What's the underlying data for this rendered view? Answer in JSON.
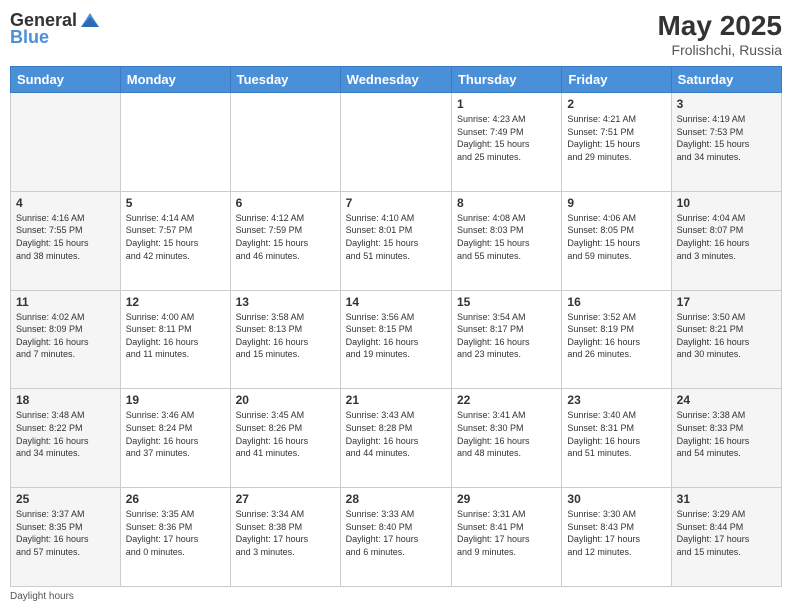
{
  "header": {
    "logo_general": "General",
    "logo_blue": "Blue",
    "month_year": "May 2025",
    "location": "Frolishchi, Russia"
  },
  "footer": {
    "note": "Daylight hours"
  },
  "days_of_week": [
    "Sunday",
    "Monday",
    "Tuesday",
    "Wednesday",
    "Thursday",
    "Friday",
    "Saturday"
  ],
  "weeks": [
    [
      {
        "day": "",
        "info": ""
      },
      {
        "day": "",
        "info": ""
      },
      {
        "day": "",
        "info": ""
      },
      {
        "day": "",
        "info": ""
      },
      {
        "day": "1",
        "info": "Sunrise: 4:23 AM\nSunset: 7:49 PM\nDaylight: 15 hours\nand 25 minutes."
      },
      {
        "day": "2",
        "info": "Sunrise: 4:21 AM\nSunset: 7:51 PM\nDaylight: 15 hours\nand 29 minutes."
      },
      {
        "day": "3",
        "info": "Sunrise: 4:19 AM\nSunset: 7:53 PM\nDaylight: 15 hours\nand 34 minutes."
      }
    ],
    [
      {
        "day": "4",
        "info": "Sunrise: 4:16 AM\nSunset: 7:55 PM\nDaylight: 15 hours\nand 38 minutes."
      },
      {
        "day": "5",
        "info": "Sunrise: 4:14 AM\nSunset: 7:57 PM\nDaylight: 15 hours\nand 42 minutes."
      },
      {
        "day": "6",
        "info": "Sunrise: 4:12 AM\nSunset: 7:59 PM\nDaylight: 15 hours\nand 46 minutes."
      },
      {
        "day": "7",
        "info": "Sunrise: 4:10 AM\nSunset: 8:01 PM\nDaylight: 15 hours\nand 51 minutes."
      },
      {
        "day": "8",
        "info": "Sunrise: 4:08 AM\nSunset: 8:03 PM\nDaylight: 15 hours\nand 55 minutes."
      },
      {
        "day": "9",
        "info": "Sunrise: 4:06 AM\nSunset: 8:05 PM\nDaylight: 15 hours\nand 59 minutes."
      },
      {
        "day": "10",
        "info": "Sunrise: 4:04 AM\nSunset: 8:07 PM\nDaylight: 16 hours\nand 3 minutes."
      }
    ],
    [
      {
        "day": "11",
        "info": "Sunrise: 4:02 AM\nSunset: 8:09 PM\nDaylight: 16 hours\nand 7 minutes."
      },
      {
        "day": "12",
        "info": "Sunrise: 4:00 AM\nSunset: 8:11 PM\nDaylight: 16 hours\nand 11 minutes."
      },
      {
        "day": "13",
        "info": "Sunrise: 3:58 AM\nSunset: 8:13 PM\nDaylight: 16 hours\nand 15 minutes."
      },
      {
        "day": "14",
        "info": "Sunrise: 3:56 AM\nSunset: 8:15 PM\nDaylight: 16 hours\nand 19 minutes."
      },
      {
        "day": "15",
        "info": "Sunrise: 3:54 AM\nSunset: 8:17 PM\nDaylight: 16 hours\nand 23 minutes."
      },
      {
        "day": "16",
        "info": "Sunrise: 3:52 AM\nSunset: 8:19 PM\nDaylight: 16 hours\nand 26 minutes."
      },
      {
        "day": "17",
        "info": "Sunrise: 3:50 AM\nSunset: 8:21 PM\nDaylight: 16 hours\nand 30 minutes."
      }
    ],
    [
      {
        "day": "18",
        "info": "Sunrise: 3:48 AM\nSunset: 8:22 PM\nDaylight: 16 hours\nand 34 minutes."
      },
      {
        "day": "19",
        "info": "Sunrise: 3:46 AM\nSunset: 8:24 PM\nDaylight: 16 hours\nand 37 minutes."
      },
      {
        "day": "20",
        "info": "Sunrise: 3:45 AM\nSunset: 8:26 PM\nDaylight: 16 hours\nand 41 minutes."
      },
      {
        "day": "21",
        "info": "Sunrise: 3:43 AM\nSunset: 8:28 PM\nDaylight: 16 hours\nand 44 minutes."
      },
      {
        "day": "22",
        "info": "Sunrise: 3:41 AM\nSunset: 8:30 PM\nDaylight: 16 hours\nand 48 minutes."
      },
      {
        "day": "23",
        "info": "Sunrise: 3:40 AM\nSunset: 8:31 PM\nDaylight: 16 hours\nand 51 minutes."
      },
      {
        "day": "24",
        "info": "Sunrise: 3:38 AM\nSunset: 8:33 PM\nDaylight: 16 hours\nand 54 minutes."
      }
    ],
    [
      {
        "day": "25",
        "info": "Sunrise: 3:37 AM\nSunset: 8:35 PM\nDaylight: 16 hours\nand 57 minutes."
      },
      {
        "day": "26",
        "info": "Sunrise: 3:35 AM\nSunset: 8:36 PM\nDaylight: 17 hours\nand 0 minutes."
      },
      {
        "day": "27",
        "info": "Sunrise: 3:34 AM\nSunset: 8:38 PM\nDaylight: 17 hours\nand 3 minutes."
      },
      {
        "day": "28",
        "info": "Sunrise: 3:33 AM\nSunset: 8:40 PM\nDaylight: 17 hours\nand 6 minutes."
      },
      {
        "day": "29",
        "info": "Sunrise: 3:31 AM\nSunset: 8:41 PM\nDaylight: 17 hours\nand 9 minutes."
      },
      {
        "day": "30",
        "info": "Sunrise: 3:30 AM\nSunset: 8:43 PM\nDaylight: 17 hours\nand 12 minutes."
      },
      {
        "day": "31",
        "info": "Sunrise: 3:29 AM\nSunset: 8:44 PM\nDaylight: 17 hours\nand 15 minutes."
      }
    ]
  ]
}
